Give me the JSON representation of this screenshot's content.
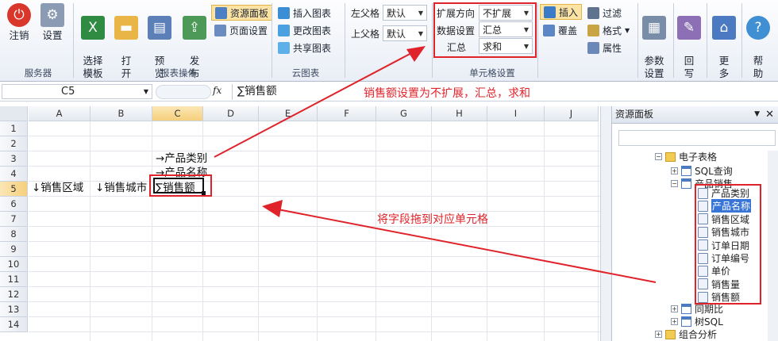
{
  "ribbon": {
    "server": {
      "logout": "注销",
      "settings": "设置",
      "group": "服务器"
    },
    "report": {
      "select_template": "选择\n模板",
      "open": "打\n开",
      "preview": "预\n览",
      "publish": "发\n布",
      "group": "报表操作"
    },
    "panels": {
      "resource_panel": "资源面板",
      "page_settings": "页面设置"
    },
    "cloud": {
      "insert_chart": "插入图表",
      "change_chart": "更改图表",
      "share_chart": "共享图表",
      "group": "云图表"
    },
    "parent": {
      "left_label": "左父格",
      "left_value": "默认",
      "top_label": "上父格",
      "top_value": "默认"
    },
    "cell": {
      "expand_label": "扩展方向",
      "expand_value": "不扩展",
      "data_label": "数据设置",
      "data_value": "汇总",
      "agg_label": "汇总",
      "agg_value": "求和",
      "group": "单元格设置"
    },
    "insert": {
      "insert": "插入",
      "cover": "覆盖"
    },
    "fmt": {
      "filter": "过滤",
      "format": "格式",
      "property": "属性"
    },
    "param": {
      "label": "参数\n设置"
    },
    "back": {
      "label": "回\n写"
    },
    "more": {
      "label": "更\n多"
    },
    "help": {
      "label": "帮\n助"
    }
  },
  "formula_bar": {
    "cell_ref": "C5",
    "fx": "fx",
    "content": "∑销售额",
    "note": "销售额设置为不扩展，汇总，求和"
  },
  "grid": {
    "columns": [
      "A",
      "B",
      "C",
      "D",
      "E",
      "F",
      "G",
      "H",
      "I",
      "J"
    ],
    "rows": [
      "1",
      "2",
      "3",
      "4",
      "5",
      "6",
      "7",
      "8",
      "9",
      "10",
      "11",
      "12",
      "13",
      "14"
    ],
    "cells": {
      "c3": "→产品类别",
      "c4": "→产品名称",
      "a5": "↓销售区域",
      "b5": "↓销售城市",
      "c5": "∑销售额"
    },
    "annotation": "将字段拖到对应单元格"
  },
  "panel": {
    "title": "资源面板",
    "tree": {
      "electronic_table": "电子表格",
      "sql_query": "SQL查询",
      "product_sales": "产品销售",
      "fields": [
        "产品类别",
        "产品名称",
        "销售区域",
        "销售城市",
        "订单日期",
        "订单编号",
        "单价",
        "销售量",
        "销售额"
      ],
      "yoy": "同期比",
      "tree_sql": "树SQL",
      "combo_analysis": "组合分析"
    }
  },
  "colors": {
    "accent_red": "#e0232a",
    "highlight": "#3875d7"
  }
}
